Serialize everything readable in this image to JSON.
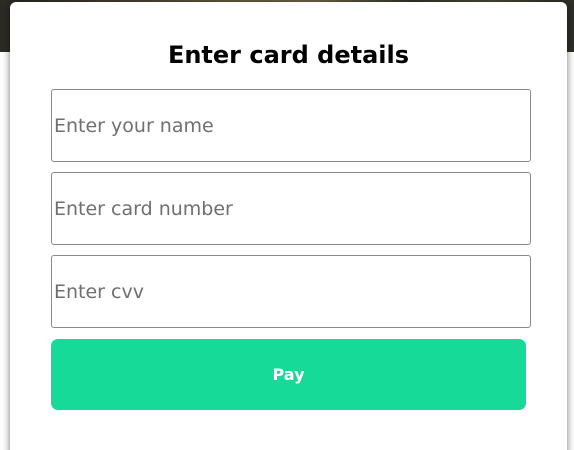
{
  "modal": {
    "title": "Enter card details",
    "fields": {
      "name": {
        "value": "",
        "placeholder": "Enter your name"
      },
      "card_number": {
        "value": "",
        "placeholder": "Enter card number"
      },
      "cvv": {
        "value": "",
        "placeholder": "Enter cvv"
      }
    },
    "pay_label": "Pay"
  },
  "colors": {
    "accent": "#16db98",
    "button_text": "#ffffff",
    "field_border": "#8a8a8a"
  }
}
